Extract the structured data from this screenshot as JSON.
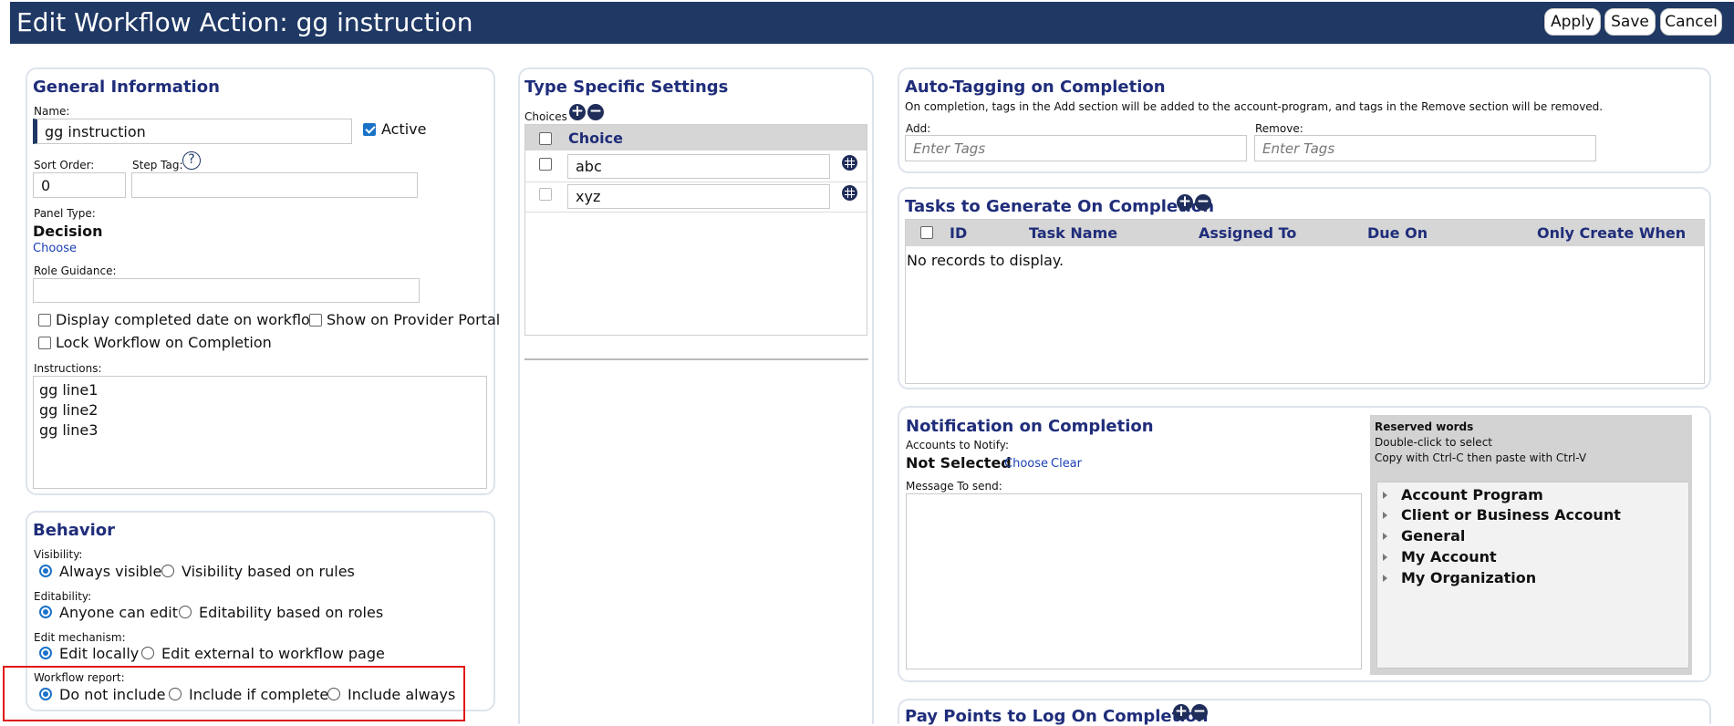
{
  "header": {
    "title": "Edit Workflow Action: gg instruction",
    "apply_label": "Apply",
    "save_label": "Save",
    "cancel_label": "Cancel",
    "background_color": "#1f3864"
  },
  "general": {
    "title": "General Information",
    "name_label": "Name:",
    "name_value": "gg instruction",
    "active_label": "Active",
    "active_checked": true,
    "sort_order_label": "Sort Order:",
    "sort_order_value": "0",
    "step_tag_label": "Step Tag:",
    "step_tag_value": "",
    "help_icon": "?",
    "panel_type_label": "Panel Type:",
    "panel_type_value": "Decision",
    "choose_link": "Choose",
    "role_guidance_label": "Role Guidance:",
    "role_guidance_value": "",
    "display_completed_label": "Display completed date on workflow",
    "show_provider_label": "Show on Provider Portal",
    "lock_workflow_label": "Lock Workflow on Completion",
    "instructions_label": "Instructions:",
    "instructions_value": "gg line1\ngg line2\ngg line3"
  },
  "behavior": {
    "title": "Behavior",
    "visibility_label": "Visibility:",
    "visibility_options": [
      "Always visible",
      "Visibility based on rules"
    ],
    "editability_label": "Editability:",
    "editability_options": [
      "Anyone can edit",
      "Editability based on roles"
    ],
    "edit_mechanism_label": "Edit mechanism:",
    "edit_mechanism_options": [
      "Edit locally",
      "Edit external to workflow page"
    ],
    "workflow_report_label": "Workflow report:",
    "workflow_report_options": [
      "Do not include",
      "Include if complete",
      "Include always"
    ],
    "highlight_color": "#e01818"
  },
  "type_settings": {
    "title": "Type Specific Settings",
    "choices_label": "Choices",
    "choice_header": "Choice",
    "choices": [
      "abc",
      "xyz"
    ]
  },
  "auto_tagging": {
    "title": "Auto-Tagging on Completion",
    "description": "On completion, tags in the Add section will be added to the account-program, and tags in the Remove section will be removed.",
    "add_label": "Add:",
    "add_placeholder": "Enter Tags",
    "remove_label": "Remove:",
    "remove_placeholder": "Enter Tags"
  },
  "tasks": {
    "title": "Tasks to Generate On Completion",
    "columns": [
      "ID",
      "Task Name",
      "Assigned To",
      "Due On",
      "Only Create When"
    ],
    "empty_text": "No records to display."
  },
  "notification": {
    "title": "Notification on Completion",
    "accounts_label": "Accounts to Notify:",
    "accounts_value": "Not Selected",
    "choose_link": "Choose",
    "clear_link": "Clear",
    "message_label": "Message To send:",
    "message_value": "",
    "reserved_title": "Reserved words",
    "reserved_hint1": "Double-click to select",
    "reserved_hint2": "Copy with Ctrl-C then paste with Ctrl-V",
    "reserved_items": [
      "Account Program",
      "Client or Business Account",
      "General",
      "My Account",
      "My Organization"
    ]
  },
  "pay_points": {
    "title": "Pay Points to Log On Completion"
  }
}
